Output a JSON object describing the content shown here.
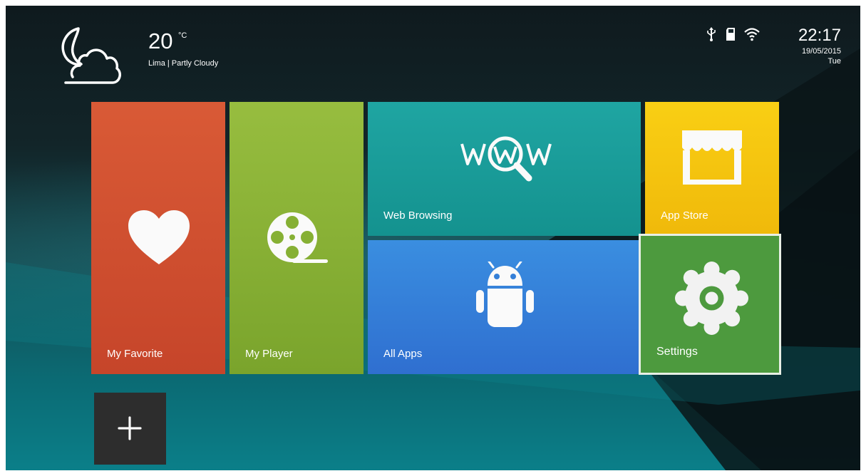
{
  "weather": {
    "temperature": "20",
    "unit": "°C",
    "location_condition": "Lima | Partly Cloudy",
    "icon": "moon-cloud-icon"
  },
  "status_bar": {
    "icons": [
      "usb-icon",
      "sd-card-icon",
      "wifi-icon"
    ],
    "time": "22:17",
    "date": "19/05/2015",
    "weekday": "Tue"
  },
  "tiles": {
    "favorite": {
      "label": "My Favorite",
      "icon": "heart-icon",
      "color": "#d3522f"
    },
    "player": {
      "label": "My Player",
      "icon": "film-reel-icon",
      "color": "#8ab537"
    },
    "web": {
      "label": "Web Browsing",
      "icon": "www-search-icon",
      "color": "#1a9e9b"
    },
    "apps": {
      "label": "All Apps",
      "icon": "android-icon",
      "color": "#3580d8"
    },
    "store": {
      "label": "App Store",
      "icon": "storefront-icon",
      "color": "#f6c50f"
    },
    "settings": {
      "label": "Settings",
      "icon": "gear-icon",
      "color": "#4d9a3e",
      "focused": true
    }
  },
  "add_button": {
    "icon": "plus-icon"
  }
}
